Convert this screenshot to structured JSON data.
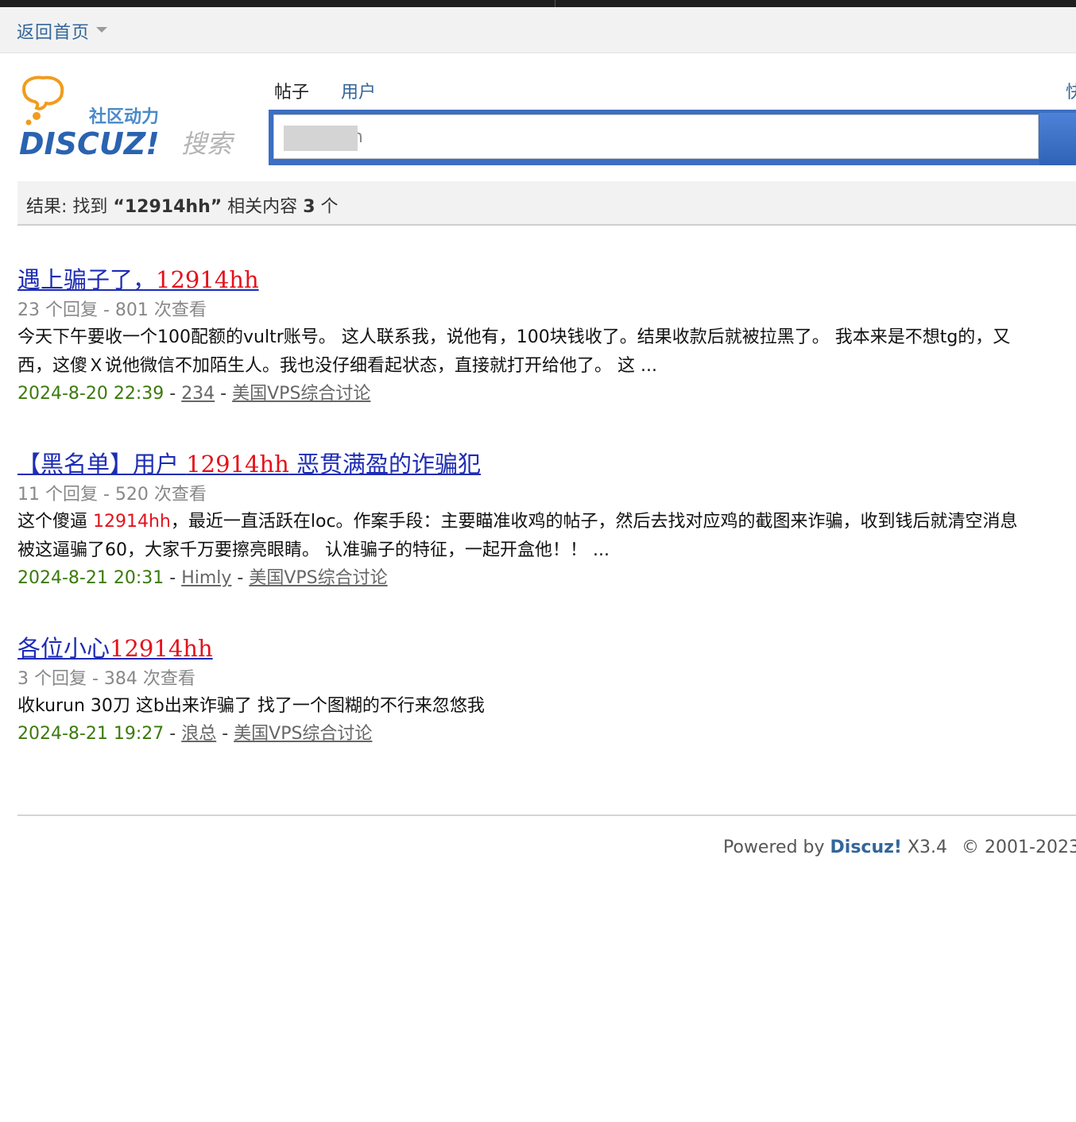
{
  "nav": {
    "home_label": "返回首页"
  },
  "logo": {
    "tagline": "社区动力",
    "brand": "DISCUZ!",
    "search_word": "搜索"
  },
  "tabs": {
    "posts": "帖子",
    "users": "用户",
    "more": "快"
  },
  "search": {
    "value": "12914hh"
  },
  "summary": {
    "prefix": "结果: 找到 ",
    "query": "“12914hh”",
    "middle": " 相关内容 ",
    "count": "3",
    "suffix": " 个"
  },
  "results": [
    {
      "title_pre": "遇上骗子了，",
      "title_hl": "12914hh",
      "title_post": "",
      "meta": "23 个回复 - 801 次查看",
      "snippet_l1_pre": "今天下午要收一个100配额的vultr账号。 这人联系我，说他有，100块钱收了。结果收款后就被拉黑了。 我本来是不想tg的，又",
      "snippet_l1_hl": "",
      "snippet_l1_post": "",
      "snippet_l2": "西，这傻Ｘ说他微信不加陌生人。我也没仔细看起状态，直接就打开给他了。 这 ...",
      "date": "2024-8-20 22:39",
      "author": "234",
      "forum": "美国VPS综合讨论"
    },
    {
      "title_pre": "【黑名单】用户 ",
      "title_hl": "12914hh",
      "title_post": " 恶贯满盈的诈骗犯",
      "meta": "11 个回复 - 520 次查看",
      "snippet_l1_pre": "这个傻逼 ",
      "snippet_l1_hl": "12914hh",
      "snippet_l1_post": "，最近一直活跃在loc。作案手段：主要瞄准收鸡的帖子，然后去找对应鸡的截图来诈骗，收到钱后就清空消息",
      "snippet_l2": "被这逼骗了60，大家千万要擦亮眼睛。 认准骗子的特征，一起开盒他！！ ...",
      "date": "2024-8-21 20:31",
      "author": "Himly",
      "forum": "美国VPS综合讨论"
    },
    {
      "title_pre": "各位小心",
      "title_hl": "12914hh",
      "title_post": "",
      "meta": "3 个回复 - 384 次查看",
      "snippet_l1_pre": "收kurun 30刀 这b出来诈骗了 找了一个图糊的不行来忽悠我",
      "snippet_l1_hl": "",
      "snippet_l1_post": "",
      "snippet_l2": "",
      "date": "2024-8-21 19:27",
      "author": "浪总",
      "forum": "美国VPS综合讨论"
    }
  ],
  "info_sep": " - ",
  "footer": {
    "powered": "Powered by ",
    "brand": "Discuz!",
    "version": " X3.4",
    "copyright": "© 2001-2023"
  },
  "colors": {
    "link": "#1e2cb5",
    "highlight": "#e4121c",
    "date": "#3b7a0c",
    "nav_link": "#336699",
    "search_border": "#3c6fc2"
  }
}
